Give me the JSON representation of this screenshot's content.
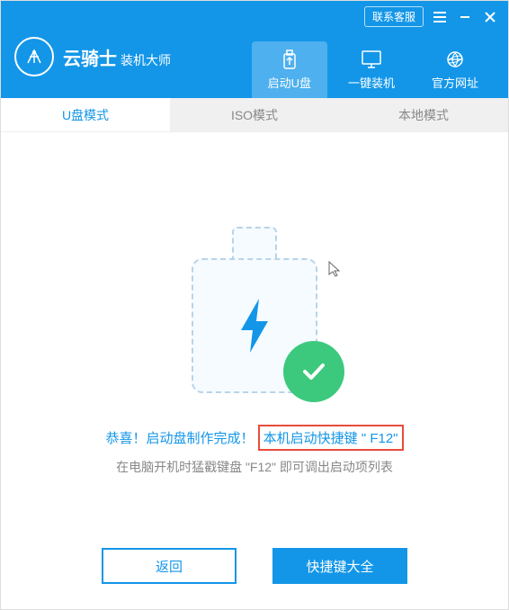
{
  "titlebar": {
    "contact": "联系客服"
  },
  "logo": {
    "title": "云骑士",
    "subtitle": "装机大师"
  },
  "nav": {
    "boot_usb": "启动U盘",
    "one_click": "一键装机",
    "official_site": "官方网址"
  },
  "mode_tabs": {
    "usb": "U盘模式",
    "iso": "ISO模式",
    "local": "本地模式"
  },
  "result": {
    "success_prefix": "恭喜！启动盘制作完成！",
    "hotkey_text": "本机启动快捷键 \" F12\"",
    "instruction": "在电脑开机时猛戳键盘 \"F12\" 即可调出启动项列表"
  },
  "buttons": {
    "back": "返回",
    "hotkey_list": "快捷键大全"
  }
}
